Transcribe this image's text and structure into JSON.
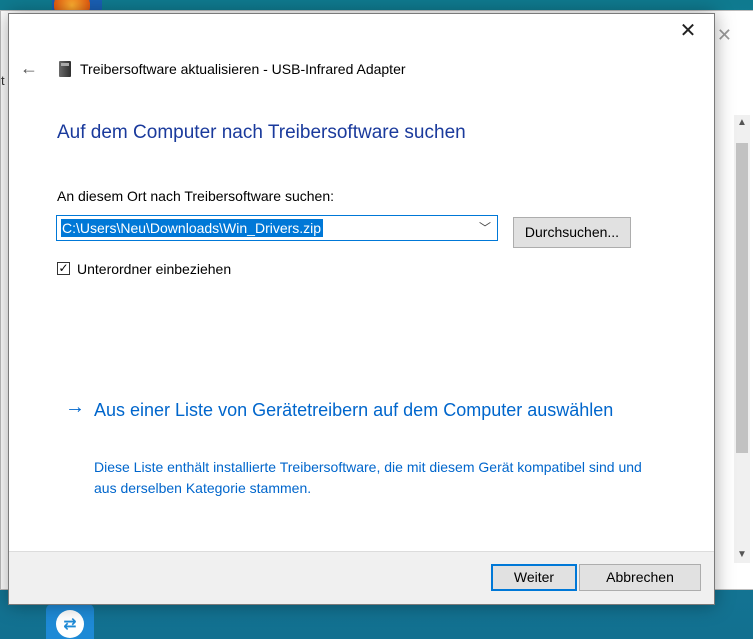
{
  "dialog": {
    "title": "Treibersoftware aktualisieren - USB-Infrared Adapter",
    "close_glyph": "✕",
    "back_glyph": "←",
    "heading": "Auf dem Computer nach Treibersoftware suchen",
    "path_label": "An diesem Ort nach Treibersoftware suchen:",
    "path_value": "C:\\Users\\Neu\\Downloads\\Win_Drivers.zip",
    "browse_label": "Durchsuchen...",
    "include_subfolders_label": "Unterordner einbeziehen",
    "include_subfolders_checked": true,
    "check_glyph": "✓",
    "list_link": {
      "arrow_glyph": "→",
      "title": "Aus einer Liste von Gerätetreibern auf dem Computer auswählen",
      "description": "Diese Liste enthält installierte Treibersoftware, die mit diesem Gerät kompatibel sind und aus derselben Kategorie stammen."
    },
    "footer": {
      "next_label": "Weiter",
      "cancel_label": "Abbrechen"
    }
  },
  "background_window": {
    "left_text": "t"
  },
  "icons": {
    "device": "usb-device-icon",
    "dropdown": "chevron-down-icon",
    "taskbar": "teamviewer-icon"
  },
  "colors": {
    "accent": "#0078d7",
    "heading": "#1a3a9c",
    "link": "#0066cc",
    "desktop": "#127090"
  }
}
